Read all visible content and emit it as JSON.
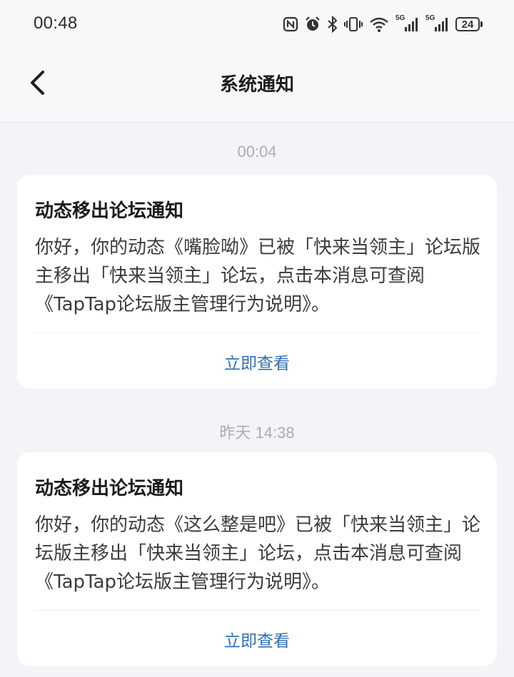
{
  "status_bar": {
    "time": "00:48",
    "battery": "24",
    "icons": [
      "nfc-icon",
      "alarm-icon",
      "bluetooth-icon",
      "vibrate-icon",
      "wifi-icon",
      "signal-5g-icon",
      "signal-5g-icon",
      "battery-icon"
    ],
    "signal_label_1": "5G",
    "signal_label_2": "5G"
  },
  "nav": {
    "title": "系统通知",
    "back_icon": "chevron-left-icon"
  },
  "notifications": [
    {
      "time": "00:04",
      "title": "动态移出论坛通知",
      "body": "你好，你的动态《嘴脸呦》已被「快来当领主」论坛版主移出「快来当领主」论坛，点击本消息可查阅《TapTap论坛版主管理行为说明》。",
      "action": "立即查看"
    },
    {
      "time": "昨天  14:38",
      "title": "动态移出论坛通知",
      "body": "你好，你的动态《这么整是吧》已被「快来当领主」论坛版主移出「快来当领主」论坛，点击本消息可查阅《TapTap论坛版主管理行为说明》。",
      "action": "立即查看"
    }
  ],
  "colors": {
    "background": "#f2f4f7",
    "card": "#ffffff",
    "action_link": "#2f6fb3",
    "time_label": "#a9adb3"
  }
}
